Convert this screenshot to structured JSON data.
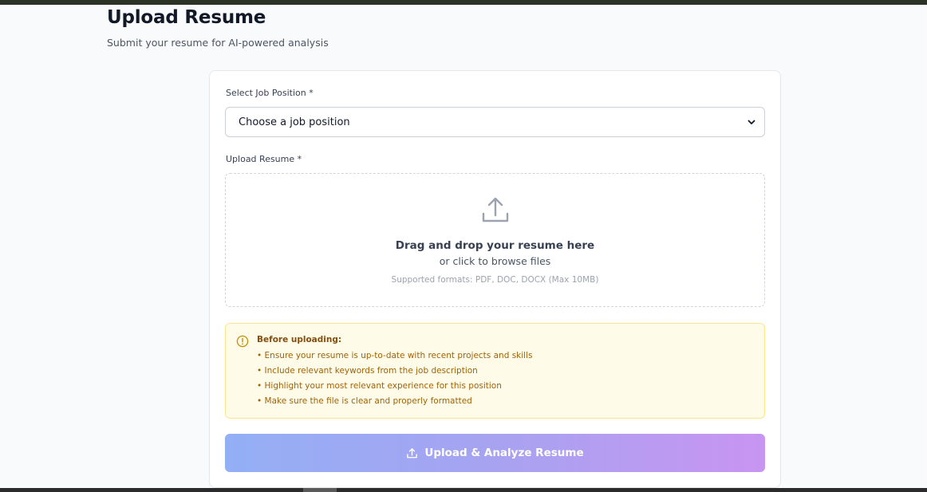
{
  "header": {
    "title": "Upload Resume",
    "subtitle": "Submit your resume for AI-powered analysis"
  },
  "form": {
    "job_position": {
      "label": "Select Job Position *",
      "selected_value": "Choose a job position",
      "icon": "chevron-down-icon"
    },
    "upload": {
      "label": "Upload Resume *",
      "icon": "upload-icon",
      "title": "Drag and drop your resume here",
      "subtitle": "or click to browse files",
      "formats": "Supported formats: PDF, DOC, DOCX (Max 10MB)"
    },
    "notice": {
      "icon": "info-circle-icon",
      "title": "Before uploading:",
      "items": [
        "• Ensure your resume is up-to-date with recent projects and skills",
        "• Include relevant keywords from the job description",
        "• Highlight your most relevant experience for this position",
        "• Make sure the file is clear and properly formatted"
      ]
    },
    "submit": {
      "label": "Upload & Analyze Resume",
      "icon": "upload-icon"
    }
  },
  "colors": {
    "accent_gradient_start": "#93aff5",
    "accent_gradient_end": "#c895f1",
    "notice_bg": "#fefce8",
    "notice_text": "#a16207"
  }
}
